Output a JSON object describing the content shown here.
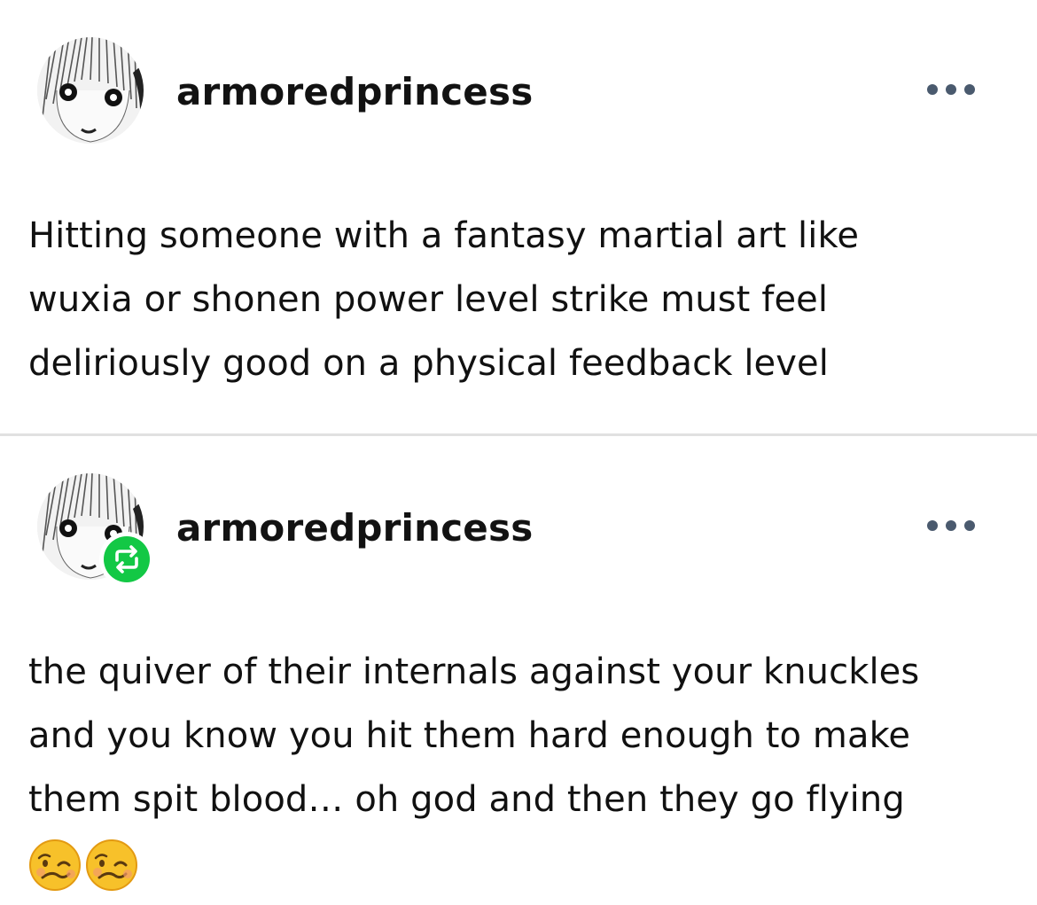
{
  "posts": [
    {
      "username": "armoredprincess",
      "reblogged": false,
      "lines": [
        "Hitting someone with a fantasy martial art like",
        "wuxia or shonen power level strike must feel",
        "deliriously good on a physical feedback level"
      ]
    },
    {
      "username": "armoredprincess",
      "reblogged": true,
      "lines": [
        "the quiver of their internals against your knuckles",
        "and you know you hit them hard enough to make",
        "them spit blood… oh god and then they go flying"
      ],
      "emojis": [
        "woozy-face-emoji",
        "woozy-face-emoji"
      ]
    }
  ],
  "colors": {
    "reblog_badge": "#13c845",
    "more_dots": "#4a5a6e",
    "divider": "#e1e1e1",
    "text": "#111111"
  },
  "icons": {
    "more": "more-options-icon",
    "reblog": "reblog-icon"
  }
}
